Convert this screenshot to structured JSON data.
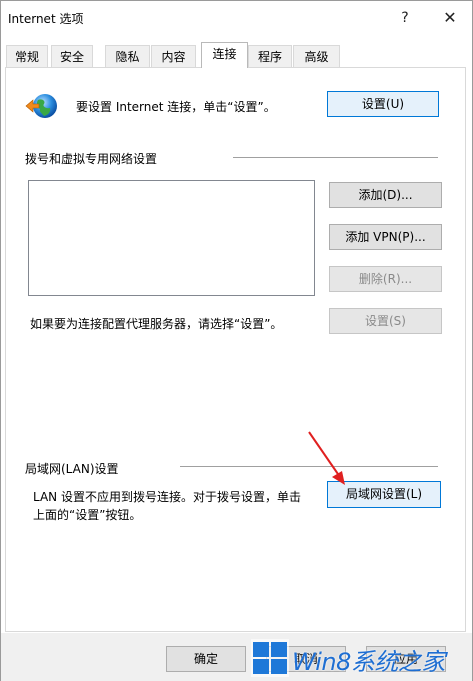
{
  "window": {
    "title": "Internet 选项",
    "help_button": "?",
    "close_button": "✕"
  },
  "tabs": [
    {
      "label": "常规"
    },
    {
      "label": "安全"
    },
    {
      "label": "隐私"
    },
    {
      "label": "内容"
    },
    {
      "label": "连接",
      "active": true
    },
    {
      "label": "程序"
    },
    {
      "label": "高级"
    }
  ],
  "setup": {
    "description": "要设置 Internet 连接，单击“设置”。",
    "button_label": "设置(U)"
  },
  "dialup": {
    "section_title": "拨号和虚拟专用网络设置",
    "add_button": "添加(D)...",
    "add_vpn_button": "添加 VPN(P)...",
    "delete_button": "删除(R)...",
    "settings_button": "设置(S)",
    "proxy_hint": "如果要为连接配置代理服务器，请选择“设置”。"
  },
  "lan": {
    "section_title": "局域网(LAN)设置",
    "description_line1": "LAN 设置不应用到拨号连接。对于拨号设置，单击",
    "description_line2": "上面的“设置”按钮。",
    "button_label": "局域网设置(L)"
  },
  "footer": {
    "ok_button": "确定",
    "cancel_button": "取消",
    "apply_button": "应用"
  },
  "watermark": {
    "text": "Win8系统之家"
  },
  "colors": {
    "focus_border": "#0078d7",
    "arrow": "#e02020",
    "watermark": "#1e6ed2"
  }
}
